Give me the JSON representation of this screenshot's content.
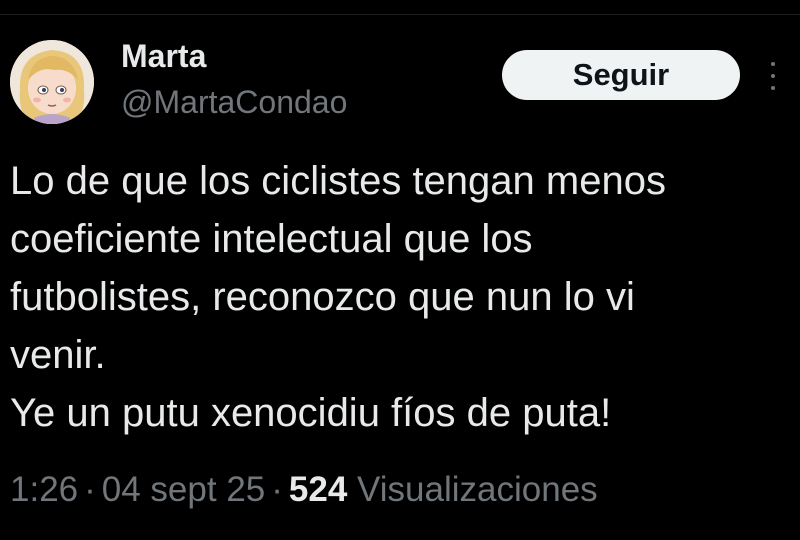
{
  "author": {
    "display_name": "Marta",
    "handle": "@MartaCondao",
    "avatar_icon": "cartoon-girl-avatar"
  },
  "follow_button": {
    "label": "Seguir"
  },
  "more_menu": {
    "icon": "more-vertical-icon"
  },
  "tweet": {
    "lines": [
      "Lo de que los ciclistes tengan menos",
      "coeficiente intelectual que los",
      "futbolistes, reconozco que nun lo vi",
      "venir.",
      "Ye un putu xenocidiu fíos de puta!"
    ]
  },
  "meta": {
    "time": "1:26",
    "separator": "·",
    "date": "04 sept 25",
    "views_count": "524",
    "views_label": "Visualizaciones"
  },
  "colors": {
    "background": "#000000",
    "primary_text": "#e7e9ea",
    "secondary_text": "#71767b",
    "button_bg": "#eff3f4",
    "button_text": "#0f1419"
  }
}
